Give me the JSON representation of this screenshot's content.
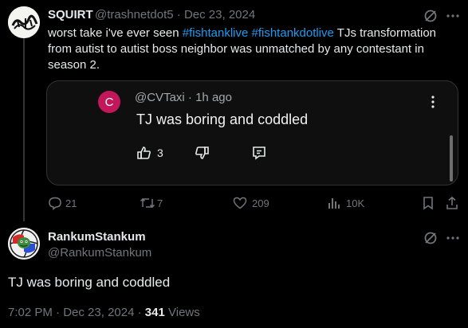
{
  "original_tweet": {
    "author_name": "SQUIRT",
    "author_handle": "@trashnetdot5",
    "separator": "·",
    "date": "Dec 23, 2024",
    "text_prefix": "worst take i've ever seen ",
    "hashtag_1": "#fishtanklive",
    "hashtag_2": "#fishtankdotlive",
    "text_suffix": " TJs transformation from autist to autist boss neighbor was unmatched by any contestant in season 2.",
    "embedded_comment": {
      "avatar_letter": "C",
      "handle": "@CVTaxi",
      "separator": "·",
      "time": "1h ago",
      "text": "TJ was boring and coddled",
      "like_count": "3"
    },
    "actions": {
      "replies": "21",
      "reposts": "7",
      "likes": "209",
      "views": "10K"
    }
  },
  "reply_tweet": {
    "author_name": "RankumStankum",
    "author_handle": "@RankumStankum",
    "text": "TJ was boring and coddled",
    "time": "7:02 PM",
    "separator": "·",
    "date": "Dec 23, 2024",
    "separator_2": "·",
    "views_count": "341",
    "views_label": "Views"
  },
  "icons": {
    "grok": "grok-icon",
    "more": "more-dots-icon",
    "reply": "reply-icon",
    "repost": "repost-icon",
    "like": "heart-icon",
    "views": "views-bars-icon",
    "bookmark": "bookmark-icon",
    "share": "share-icon",
    "thumbs_up": "thumbs-up-icon",
    "thumbs_down": "thumbs-down-icon",
    "comment": "comment-icon"
  },
  "colors": {
    "background": "#000000",
    "text": "#e7e9ea",
    "muted": "#71767b",
    "link": "#1d9bf0",
    "embed_avatar": "#c2185b"
  }
}
